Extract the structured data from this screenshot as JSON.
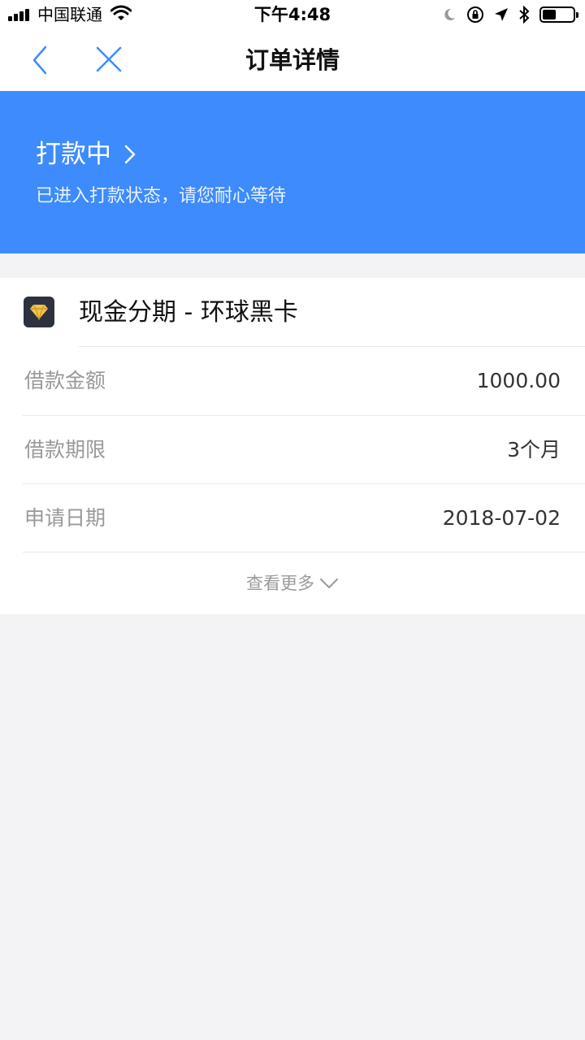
{
  "status_bar": {
    "carrier": "中国联通",
    "time": "下午4:48",
    "battery_level": 0.45
  },
  "nav": {
    "title": "订单详情"
  },
  "banner": {
    "status": "打款中",
    "subtitle": "已进入打款状态，请您耐心等待",
    "color": "#3d8bfd"
  },
  "product": {
    "name": "现金分期 - 环球黑卡",
    "icon": "diamond-icon"
  },
  "details": [
    {
      "label": "借款金额",
      "value": "1000.00"
    },
    {
      "label": "借款期限",
      "value": "3个月"
    },
    {
      "label": "申请日期",
      "value": "2018-07-02"
    }
  ],
  "more": {
    "label": "查看更多"
  }
}
